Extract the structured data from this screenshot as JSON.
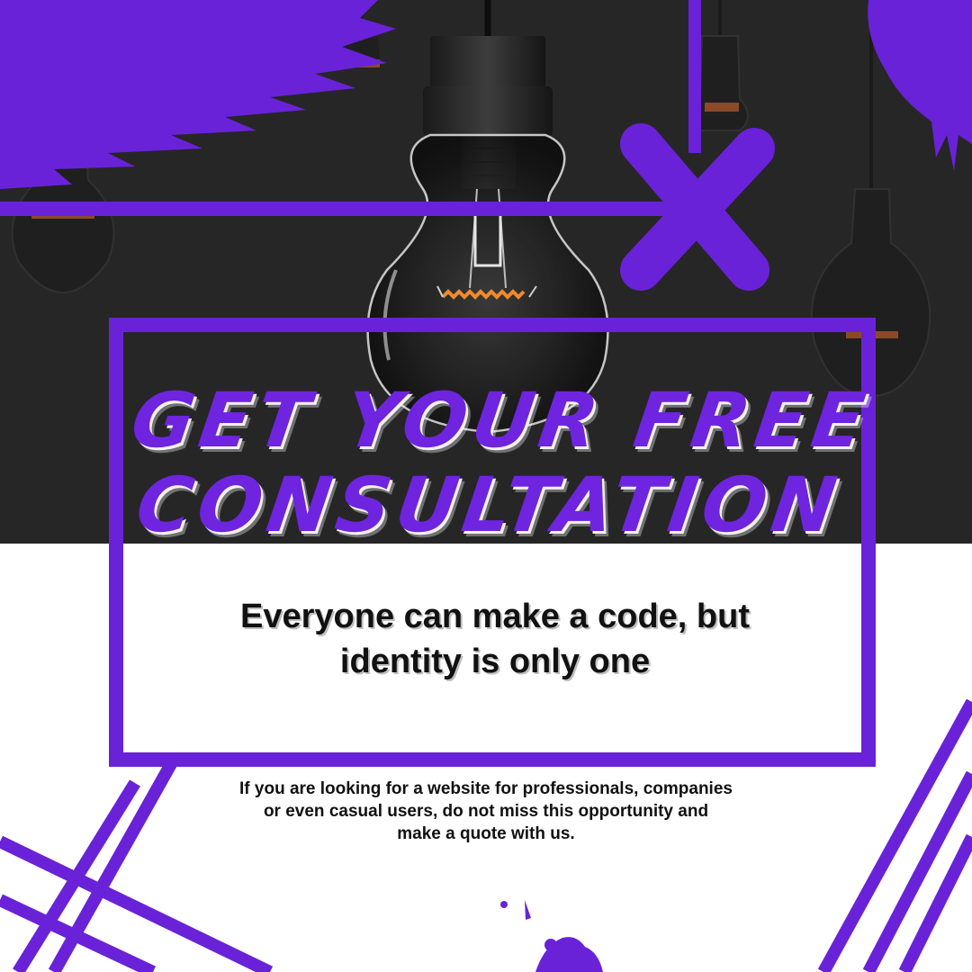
{
  "poster": {
    "headline_line1": "GET YOUR FREE",
    "headline_line2": "CONSULTATION",
    "tagline_line1": "Everyone can make a code, but",
    "tagline_line2": "identity is only one",
    "body_line1": "If you are looking for a website for professionals, companies",
    "body_line2": "or even casual users, do not miss this opportunity and",
    "body_line3": "make a quote with us."
  },
  "colors": {
    "accent": "#6a22d8",
    "background_dark": "#262626",
    "background_light": "#ffffff",
    "text": "#111111",
    "filament": "#f08a2a"
  },
  "icons": [
    "light-bulb-icon",
    "x-mark-icon",
    "paint-splash-icon"
  ]
}
